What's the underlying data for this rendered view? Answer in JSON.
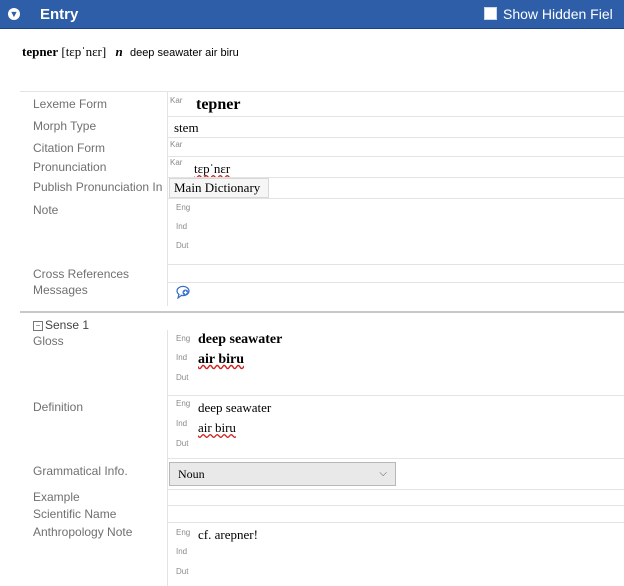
{
  "header": {
    "title": "Entry",
    "show_hidden": "Show Hidden Fiel"
  },
  "summary": {
    "headword": "tepner",
    "pronunciation": "[tɛpˈnɛr]",
    "pos": "n",
    "definitions": "deep seawater air biru"
  },
  "fields": {
    "lexeme_form": {
      "label": "Lexeme Form",
      "ws": "Kar",
      "value": "tepner"
    },
    "morph_type": {
      "label": "Morph Type",
      "value": "stem"
    },
    "citation_form": {
      "label": "Citation Form",
      "ws": "Kar"
    },
    "pronunciation": {
      "label": "Pronunciation",
      "ws": "Kar",
      "value": "tɛpˈnɛr"
    },
    "publish": {
      "label": "Publish Pronunciation In",
      "value": "Main Dictionary"
    },
    "note": {
      "label": "Note",
      "ws": [
        "Eng",
        "Ind",
        "Dut"
      ]
    },
    "cross_refs": {
      "label": "Cross References"
    },
    "messages": {
      "label": "Messages"
    }
  },
  "sense": {
    "header": "Sense 1",
    "toggle": "−",
    "gloss": {
      "label": "Gloss",
      "ws": [
        "Eng",
        "Ind",
        "Dut"
      ],
      "values": [
        "deep seawater",
        "air biru",
        ""
      ]
    },
    "definition": {
      "label": "Definition",
      "ws": [
        "Eng",
        "Ind",
        "Dut"
      ],
      "values": [
        "deep seawater",
        "air biru",
        ""
      ]
    },
    "gram_info": {
      "label": "Grammatical Info.",
      "value": "Noun",
      "chevron": "⌵"
    },
    "example": {
      "label": "Example"
    },
    "scientific": {
      "label": "Scientific Name"
    },
    "anthropology": {
      "label": "Anthropology Note",
      "ws": [
        "Eng",
        "Ind",
        "Dut"
      ],
      "values": [
        "cf. arepner!",
        "",
        ""
      ]
    }
  },
  "icons": {
    "collapse": "collapse-circle-icon",
    "checkbox": "checkbox-icon",
    "messages": "add-message-icon",
    "dropdown": "chevron-down-icon"
  },
  "colors": {
    "header_bg": "#2f5ea8",
    "label_gray": "#707070",
    "spell_red": "#d02020"
  }
}
